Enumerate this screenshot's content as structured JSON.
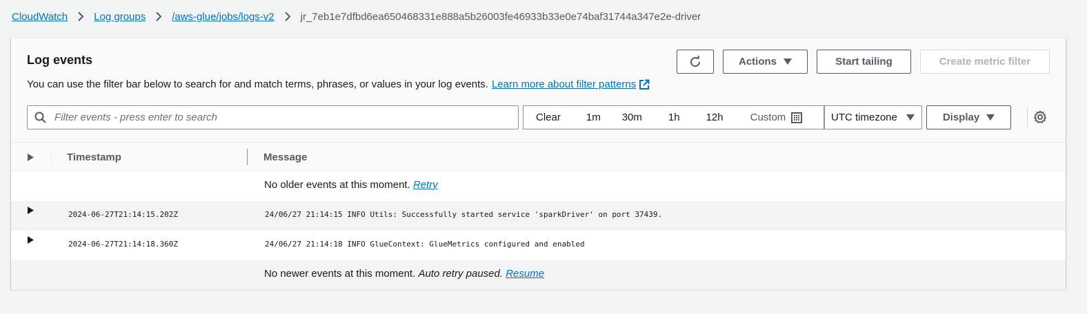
{
  "breadcrumb": {
    "items": [
      "CloudWatch",
      "Log groups",
      "/aws-glue/jobs/logs-v2"
    ],
    "current": "jr_7eb1e7dfbd6ea650468331e888a5b26003fe46933b33e0e74baf31744a347e2e-driver"
  },
  "panel": {
    "title": "Log events",
    "description": "You can use the filter bar below to search for and match terms, phrases, or values in your log events.",
    "learn_more": "Learn more about filter patterns"
  },
  "toolbar": {
    "actions_label": "Actions",
    "start_tailing_label": "Start tailing",
    "create_metric_filter_label": "Create metric filter"
  },
  "filter": {
    "placeholder": "Filter events - press enter to search"
  },
  "timerange": {
    "clear": "Clear",
    "options": [
      "1m",
      "30m",
      "1h",
      "12h"
    ],
    "custom": "Custom"
  },
  "timezone": "UTC timezone",
  "display_label": "Display",
  "table": {
    "columns": [
      "Timestamp",
      "Message"
    ],
    "older_status": "No older events at this moment.",
    "older_retry": "Retry",
    "rows": [
      {
        "timestamp": "2024-06-27T21:14:15.202Z",
        "message": "24/06/27 21:14:15 INFO Utils: Successfully started service 'sparkDriver' on port 37439."
      },
      {
        "timestamp": "2024-06-27T21:14:18.360Z",
        "message": "24/06/27 21:14:18 INFO GlueContext: GlueMetrics configured and enabled"
      }
    ],
    "newer_status": "No newer events at this moment.",
    "newer_paused": "Auto retry paused.",
    "newer_resume": "Resume"
  },
  "colors": {
    "link": "#0073bb",
    "text": "#16191f",
    "muted": "#545b64",
    "page_bg": "#f2f3f3"
  }
}
